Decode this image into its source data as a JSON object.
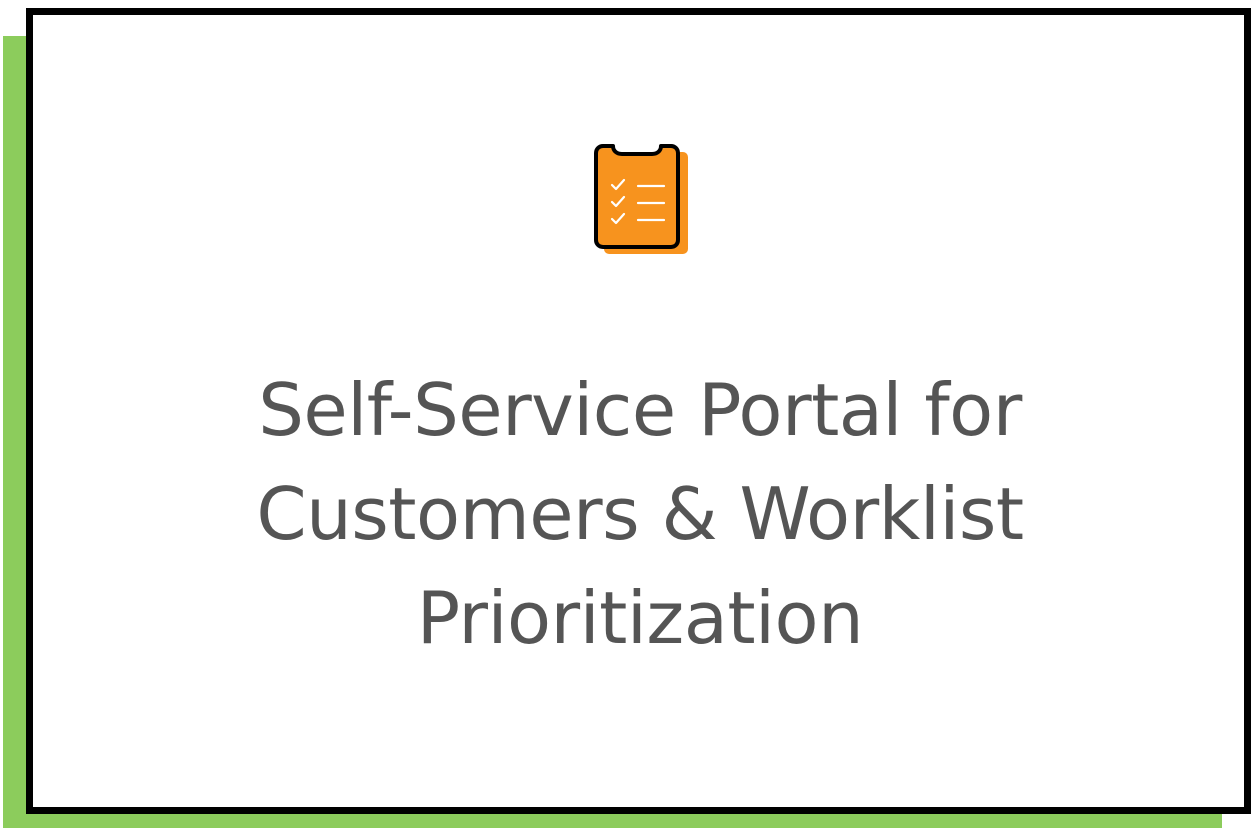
{
  "card": {
    "title_lines": [
      "Self-Service Portal for",
      "Customers & Worklist",
      "Prioritization"
    ],
    "icon": "clipboard-checklist-icon"
  },
  "colors": {
    "accent_green": "#8ccc5c",
    "icon_orange": "#f7931e",
    "border": "#000000",
    "text": "#555555"
  }
}
